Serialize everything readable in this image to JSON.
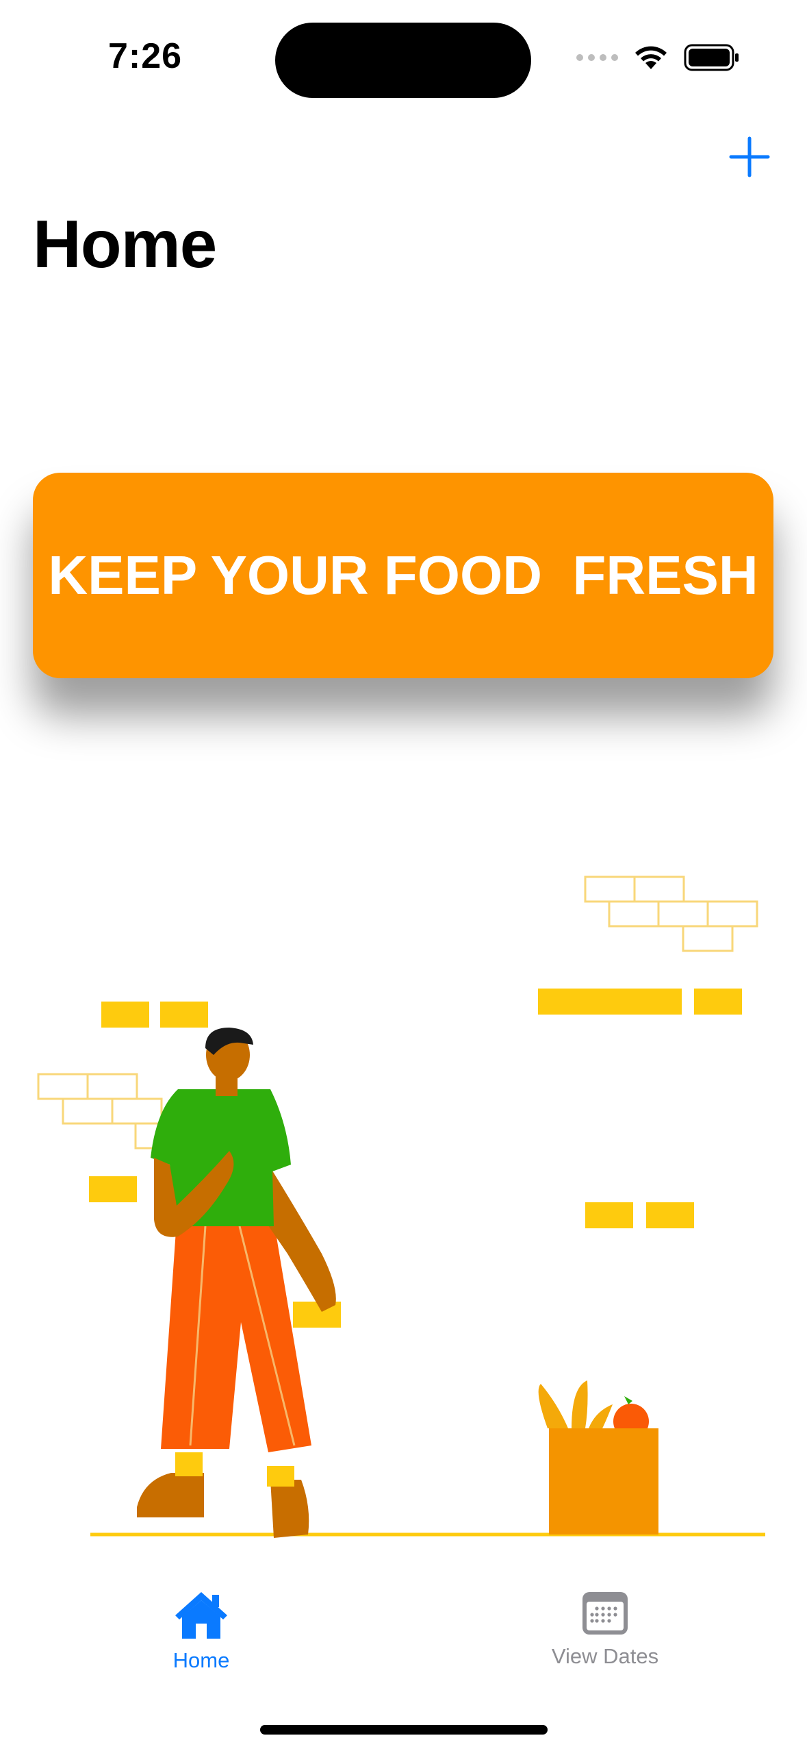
{
  "status_bar": {
    "time": "7:26"
  },
  "nav": {
    "title": "Home",
    "add_icon": "plus-icon"
  },
  "banner": {
    "text": "KEEP YOUR FOOD  FRESH",
    "color": "#fe9400"
  },
  "tab_bar": {
    "active_color": "#0a7aff",
    "inactive_color": "#8e8e93",
    "tabs": [
      {
        "label": "Home",
        "icon": "house-icon",
        "selected": true
      },
      {
        "label": "View Dates",
        "icon": "calendar-icon",
        "selected": false
      }
    ]
  }
}
